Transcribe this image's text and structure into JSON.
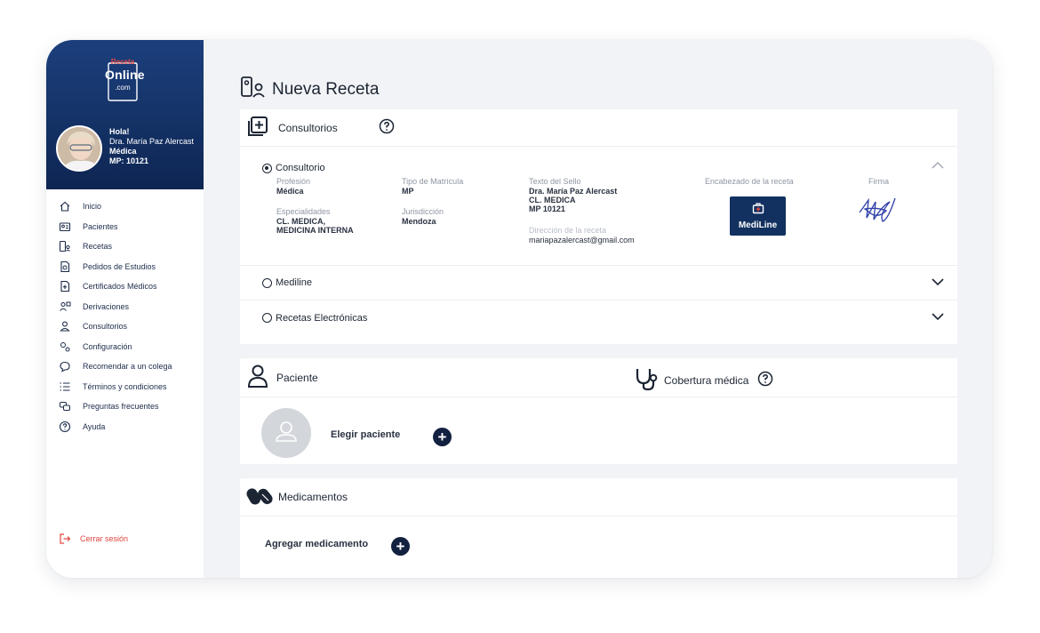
{
  "sidebar": {
    "logo": {
      "top": "Receta",
      "main": "Online",
      "suffix": ".com"
    },
    "user": {
      "greeting": "Hola!",
      "name": "Dra. María Paz Alercast",
      "role": "Médica",
      "license": "MP: 10121"
    },
    "items": [
      {
        "label": "Inicio",
        "icon": "home-icon"
      },
      {
        "label": "Pacientes",
        "icon": "id-card-icon"
      },
      {
        "label": "Recetas",
        "icon": "prescription-icon"
      },
      {
        "label": "Pedidos de Estudios",
        "icon": "study-doc-icon"
      },
      {
        "label": "Certificados Médicos",
        "icon": "certificate-icon"
      },
      {
        "label": "Derivaciones",
        "icon": "referral-icon"
      },
      {
        "label": "Consultorios",
        "icon": "office-user-icon"
      },
      {
        "label": "Configuración",
        "icon": "gears-icon"
      },
      {
        "label": "Recomendar a un colega",
        "icon": "recommend-icon"
      },
      {
        "label": "Términos y condiciones",
        "icon": "list-icon"
      },
      {
        "label": "Preguntas frecuentes",
        "icon": "faq-icon"
      },
      {
        "label": "Ayuda",
        "icon": "help-icon"
      }
    ],
    "logout": "Cerrar sesión"
  },
  "main": {
    "title": "Nueva Receta",
    "consultorios": {
      "title": "Consultorios",
      "selected": {
        "name": "Consultorio",
        "profesion_label": "Profesión",
        "profesion": "Médica",
        "matricula_label": "Tipo de Matrícula",
        "matricula": "MP",
        "especialidades_label": "Especialidades",
        "especialidades": [
          "CL. MEDICA,",
          "MEDICINA INTERNA"
        ],
        "jurisdiccion_label": "Jurisdicción",
        "jurisdiccion": "Mendoza",
        "sello_label": "Texto del Sello",
        "sello": [
          "Dra. María Paz Alercast",
          "CL. MEDICA",
          "MP 10121"
        ],
        "direccion_label": "Dirección de la receta",
        "direccion": "mariapazalercast@gmail.com",
        "encabezado_label": "Encabezado de la receta",
        "encabezado_logo": "MediLine",
        "firma_label": "Firma"
      },
      "options": [
        "Mediline",
        "Recetas Electrónicas"
      ]
    },
    "paciente": {
      "title": "Paciente",
      "cobertura": "Cobertura médica",
      "elegir": "Elegir paciente"
    },
    "medicamentos": {
      "title": "Medicamentos",
      "agregar": "Agregar medicamento"
    }
  },
  "colors": {
    "sidebar_header": "#143266",
    "logout": "#e2453d",
    "accent_dark": "#12213f",
    "logo_red": "#e04848"
  }
}
